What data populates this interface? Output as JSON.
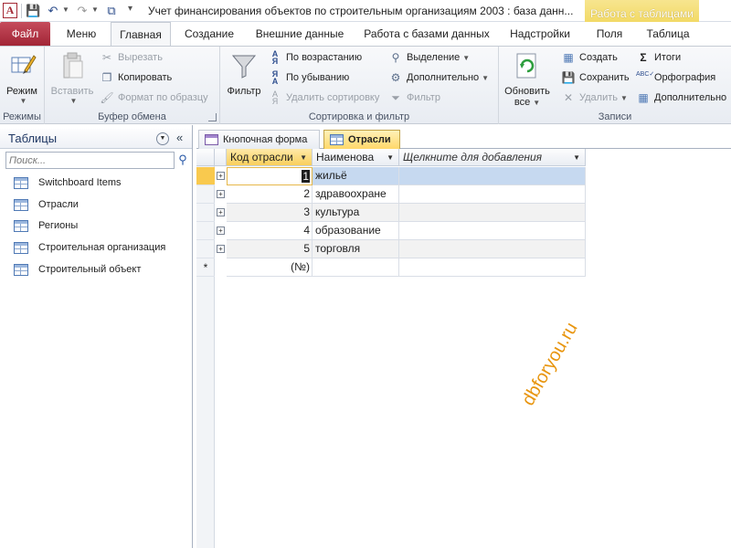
{
  "window": {
    "title": "Учет финансирования объектов по строительным организациям 2003 : база данн...",
    "context_tab": "Работа с таблицами"
  },
  "tabs": [
    {
      "label": "Файл"
    },
    {
      "label": "Меню"
    },
    {
      "label": "Главная"
    },
    {
      "label": "Создание"
    },
    {
      "label": "Внешние данные"
    },
    {
      "label": "Работа с базами данных"
    },
    {
      "label": "Надстройки"
    },
    {
      "label": "Поля"
    },
    {
      "label": "Таблица"
    }
  ],
  "ribbon": {
    "modes": {
      "label": "Режимы",
      "mode_button": "Режим"
    },
    "clipboard": {
      "label": "Буфер обмена",
      "paste": "Вставить",
      "cut": "Вырезать",
      "copy": "Копировать",
      "format_painter": "Формат по образцу"
    },
    "sort_filter": {
      "label": "Сортировка и фильтр",
      "filter": "Фильтр",
      "ascending": "По возрастанию",
      "descending": "По убыванию",
      "remove_sort": "Удалить сортировку",
      "selection": "Выделение",
      "advanced": "Дополнительно",
      "toggle_filter": "Фильтр"
    },
    "records": {
      "label": "Записи",
      "refresh_line1": "Обновить",
      "refresh_line2": "все",
      "new": "Создать",
      "save": "Сохранить",
      "delete": "Удалить",
      "totals": "Итоги",
      "spelling": "Орфография",
      "more": "Дополнительно"
    }
  },
  "nav": {
    "title": "Таблицы",
    "search_placeholder": "Поиск...",
    "items": [
      {
        "label": "Switchboard Items"
      },
      {
        "label": "Отрасли"
      },
      {
        "label": "Регионы"
      },
      {
        "label": "Строительная организация"
      },
      {
        "label": "Строительный объект"
      }
    ]
  },
  "documents": [
    {
      "label": "Кнопочная форма"
    },
    {
      "label": "Отрасли"
    }
  ],
  "datasheet": {
    "columns": [
      "Код отрасли",
      "Наименова",
      "Щелкните для добавления"
    ],
    "rows": [
      {
        "id": "1",
        "name": "жильё"
      },
      {
        "id": "2",
        "name": "здравоохране"
      },
      {
        "id": "3",
        "name": "культура"
      },
      {
        "id": "4",
        "name": "образование"
      },
      {
        "id": "5",
        "name": "торговля"
      }
    ],
    "new_row_marker": "(№)",
    "new_row_selector": "*"
  },
  "watermark": "dbforyou.ru"
}
